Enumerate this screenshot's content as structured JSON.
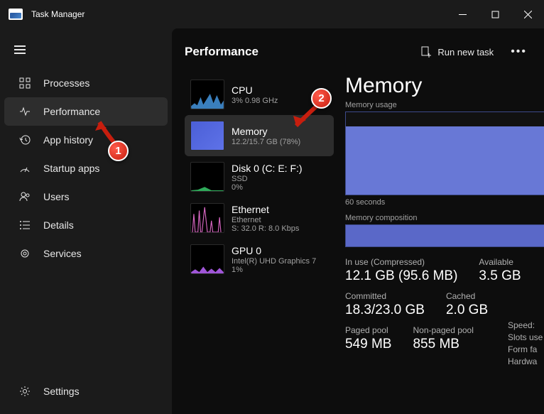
{
  "title": "Task Manager",
  "topbar": {
    "title": "Performance",
    "run_task": "Run new task"
  },
  "sidebar": {
    "items": [
      {
        "label": "Processes"
      },
      {
        "label": "Performance"
      },
      {
        "label": "App history"
      },
      {
        "label": "Startup apps"
      },
      {
        "label": "Users"
      },
      {
        "label": "Details"
      },
      {
        "label": "Services"
      }
    ],
    "settings": "Settings"
  },
  "perf_items": [
    {
      "name": "CPU",
      "stat": "3%   0.98 GHz"
    },
    {
      "name": "Memory",
      "stat": "12.2/15.7 GB (78%)"
    },
    {
      "name": "Disk 0 (C: E: F:)",
      "stat": "SSD\n0%"
    },
    {
      "name": "Ethernet",
      "stat": "Ethernet\nS: 32.0 R: 8.0 Kbps"
    },
    {
      "name": "GPU 0",
      "stat": "Intel(R) UHD Graphics 7\n1%"
    }
  ],
  "detail": {
    "title": "Memory",
    "usage_label": "Memory usage",
    "axis": "60 seconds",
    "comp_label": "Memory composition",
    "stats": [
      {
        "label": "In use (Compressed)",
        "value": "12.1 GB (95.6 MB)"
      },
      {
        "label": "Available",
        "value": "3.5 GB"
      },
      {
        "label": "Committed",
        "value": "18.3/23.0 GB"
      },
      {
        "label": "Cached",
        "value": "2.0 GB"
      },
      {
        "label": "Paged pool",
        "value": "549 MB"
      },
      {
        "label": "Non-paged pool",
        "value": "855 MB"
      }
    ],
    "extra": [
      "Speed:",
      "Slots use",
      "Form fa",
      "Hardwa"
    ]
  },
  "annotations": {
    "1": "1",
    "2": "2"
  }
}
